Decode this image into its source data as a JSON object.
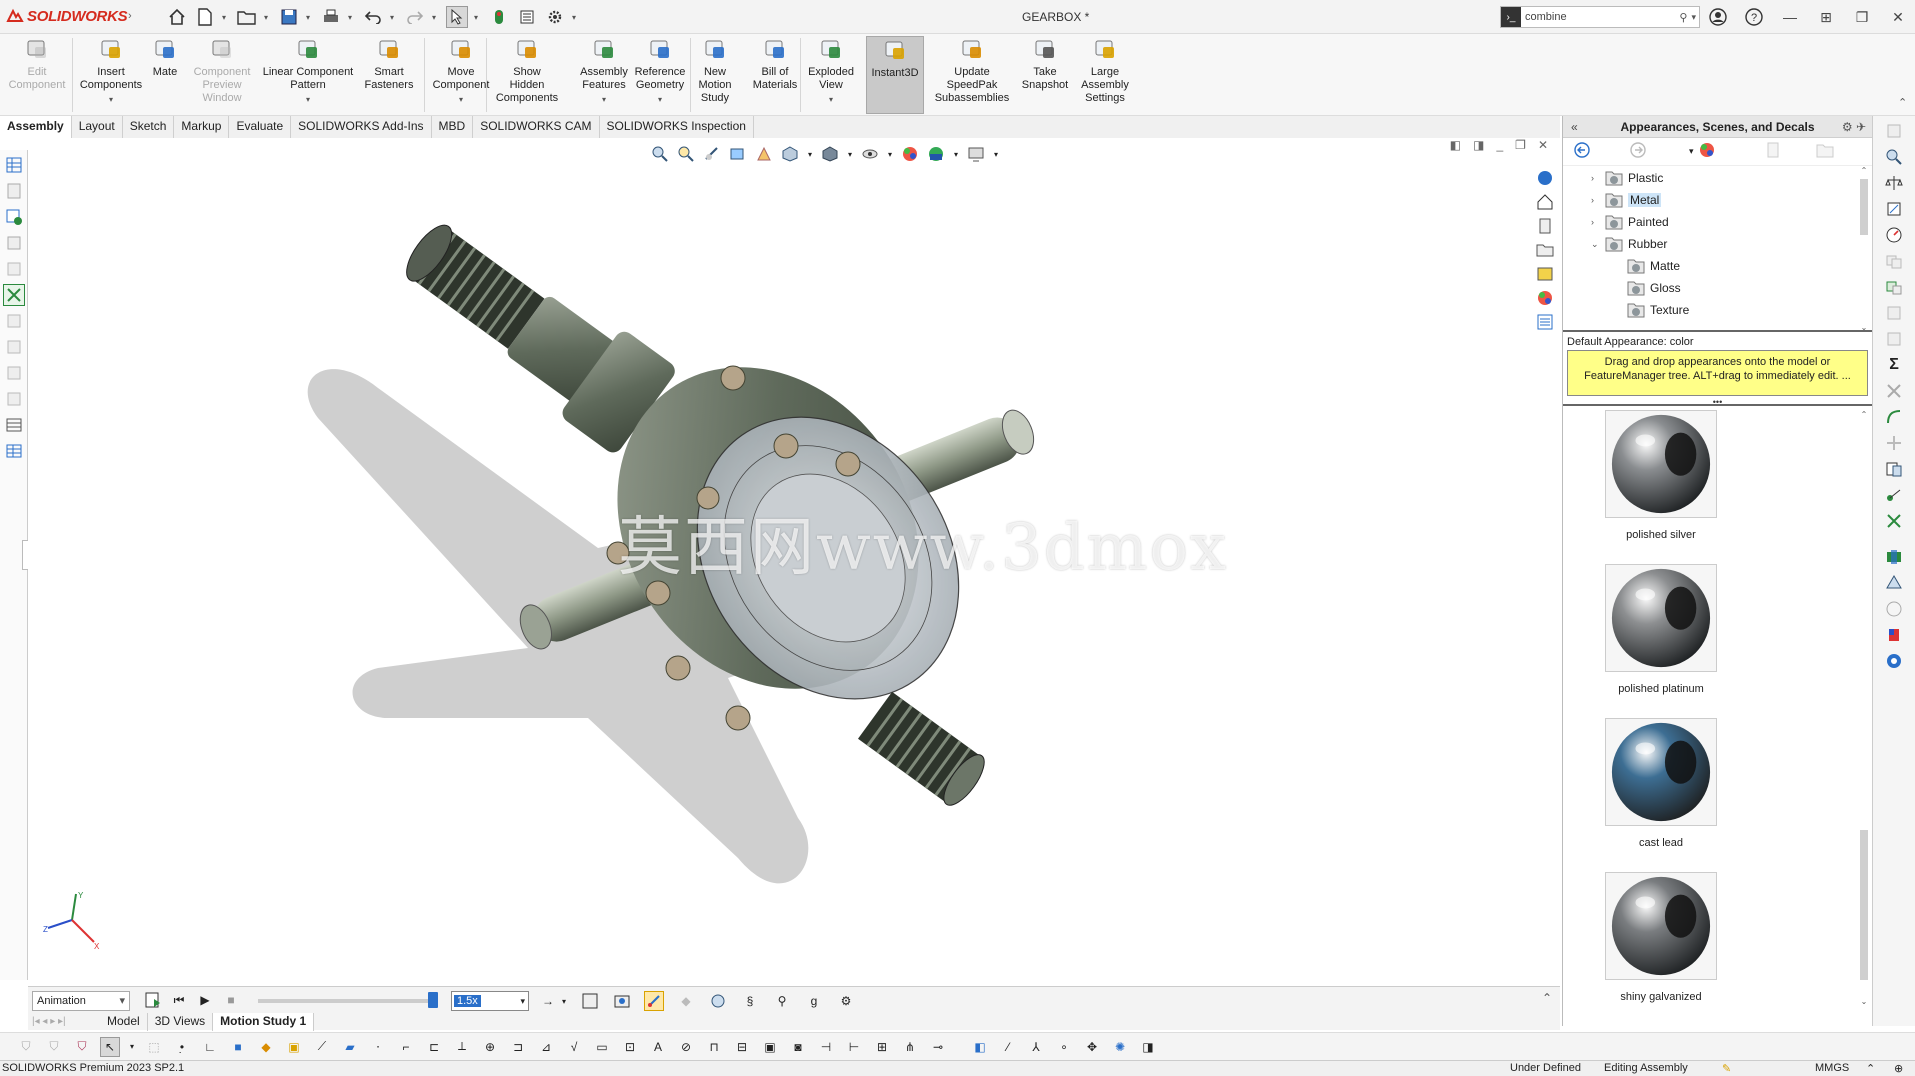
{
  "app": {
    "logo_text": "SOLIDWORKS",
    "document_title": "GEARBOX *",
    "search_value": "combine"
  },
  "ribbon": {
    "buttons": [
      {
        "label": "Edit Component",
        "lines": [
          "Edit",
          "Component"
        ],
        "disabled": true
      },
      {
        "label": "Insert Components",
        "lines": [
          "Insert",
          "Components"
        ]
      },
      {
        "label": "Mate",
        "lines": [
          "Mate"
        ]
      },
      {
        "label": "Component Preview Window",
        "lines": [
          "Component",
          "Preview",
          "Window"
        ],
        "disabled": true
      },
      {
        "label": "Linear Component Pattern",
        "lines": [
          "Linear Component",
          "Pattern"
        ]
      },
      {
        "label": "Smart Fasteners",
        "lines": [
          "Smart",
          "Fasteners"
        ]
      },
      {
        "label": "Move Component",
        "lines": [
          "Move",
          "Component"
        ]
      },
      {
        "label": "Show Hidden Components",
        "lines": [
          "Show",
          "Hidden",
          "Components"
        ]
      },
      {
        "label": "Assembly Features",
        "lines": [
          "Assembly",
          "Features"
        ]
      },
      {
        "label": "Reference Geometry",
        "lines": [
          "Reference",
          "Geometry"
        ]
      },
      {
        "label": "New Motion Study",
        "lines": [
          "New",
          "Motion",
          "Study"
        ]
      },
      {
        "label": "Bill of Materials",
        "lines": [
          "Bill of",
          "Materials"
        ]
      },
      {
        "label": "Exploded View",
        "lines": [
          "Exploded",
          "View"
        ]
      },
      {
        "label": "Instant3D",
        "lines": [
          "Instant3D"
        ],
        "active": true
      },
      {
        "label": "Update SpeedPak Subassemblies",
        "lines": [
          "Update",
          "SpeedPak",
          "Subassemblies"
        ]
      },
      {
        "label": "Take Snapshot",
        "lines": [
          "Take",
          "Snapshot"
        ]
      },
      {
        "label": "Large Assembly Settings",
        "lines": [
          "Large",
          "Assembly",
          "Settings"
        ]
      }
    ]
  },
  "tabs": [
    "Assembly",
    "Layout",
    "Sketch",
    "Markup",
    "Evaluate",
    "SOLIDWORKS Add-Ins",
    "MBD",
    "SOLIDWORKS CAM",
    "SOLIDWORKS Inspection"
  ],
  "graphics": {
    "watermark": "莫西网www.3dmox"
  },
  "taskpane": {
    "title": "Appearances, Scenes, and Decals",
    "tree": [
      {
        "label": "Plastic",
        "level": 0,
        "expander": "›"
      },
      {
        "label": "Metal",
        "level": 0,
        "expander": "›",
        "selected": true
      },
      {
        "label": "Painted",
        "level": 0,
        "expander": "›"
      },
      {
        "label": "Rubber",
        "level": 0,
        "expander": "⌄"
      },
      {
        "label": "Matte",
        "level": 1,
        "expander": ""
      },
      {
        "label": "Gloss",
        "level": 1,
        "expander": ""
      },
      {
        "label": "Texture",
        "level": 1,
        "expander": ""
      }
    ],
    "default_appearance": "Default Appearance: color",
    "tip": "Drag and drop appearances onto the model or FeatureManager tree.  ALT+drag to immediately edit. ...",
    "swatches": [
      {
        "label": "polished silver",
        "color": "#8a8d90"
      },
      {
        "label": "polished platinum",
        "color": "#8d8f91"
      },
      {
        "label": "cast lead",
        "color": "#3d6e93"
      },
      {
        "label": "shiny galvanized",
        "color": "#7a7d80"
      }
    ]
  },
  "motion": {
    "type": "Animation",
    "speed": "1.5x",
    "tabs": [
      "Model",
      "3D Views",
      "Motion Study 1"
    ],
    "active_tab": "Motion Study 1"
  },
  "statusbar": {
    "product": "SOLIDWORKS Premium 2023 SP2.1",
    "state": "Under Defined",
    "mode": "Editing Assembly",
    "units": "MMGS"
  }
}
